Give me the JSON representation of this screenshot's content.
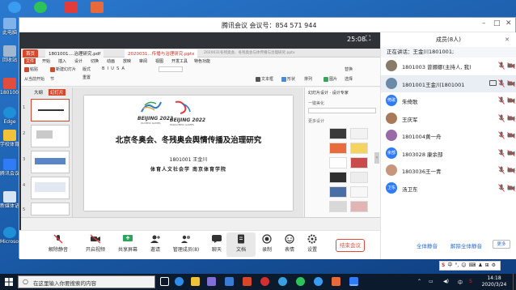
{
  "desktop": {
    "icons": [
      {
        "label": "此电脑",
        "color": "#7fb3ea"
      },
      {
        "label": "回收站",
        "color": "#9fb7cf"
      },
      {
        "label": "1801001.pdf",
        "color": "#e04d3c"
      },
      {
        "label": "Edge",
        "color": "#1f8fd8"
      },
      {
        "label": "学校体育学教学资源",
        "color": "#f0c23a"
      },
      {
        "label": "腾讯会议",
        "color": "#2f7cf6"
      },
      {
        "label": "新媒体语境民健身",
        "color": "#d6e4f3"
      },
      {
        "label": "Microsoft Edge",
        "color": "#1f8fd8"
      }
    ],
    "top_icons": [
      {
        "name": "qq",
        "color": "#3a9cf0"
      },
      {
        "name": "wechat",
        "color": "#2dc35a"
      },
      {
        "name": "voice",
        "color": "#e23b3b"
      },
      {
        "name": "wps",
        "color": "#e86a3a"
      }
    ]
  },
  "meeting": {
    "title": "腾讯会议 会议号：854 571 944",
    "timer": "25:08",
    "toolbar": [
      {
        "label": "解除静音",
        "icon": "mic-muted-icon"
      },
      {
        "label": "开启视频",
        "icon": "camera-off-icon"
      },
      {
        "label": "共享屏幕",
        "icon": "share-screen-icon"
      },
      {
        "label": "邀请",
        "icon": "invite-icon"
      },
      {
        "label": "管理成员(8)",
        "icon": "members-icon"
      },
      {
        "label": "聊天",
        "icon": "chat-icon"
      },
      {
        "label": "文档",
        "icon": "document-icon"
      },
      {
        "label": "录制",
        "icon": "record-icon"
      },
      {
        "label": "表情",
        "icon": "emoji-icon"
      },
      {
        "label": "设置",
        "icon": "settings-icon"
      }
    ],
    "end_button": "结束会议"
  },
  "members_panel": {
    "title": "成员(8人)",
    "speaking": "正在讲话：王金川1801001;",
    "members": [
      {
        "name": "1801003 曾娜娜(主持人, 我)",
        "avatar": "",
        "avatar_color": "#8a7a6a",
        "selected": false
      },
      {
        "name": "1801001王金川1801001",
        "avatar": "",
        "avatar_color": "#6a8aa8",
        "selected": true
      },
      {
        "name": "朱倚歌",
        "avatar": "倚歌",
        "avatar_color": "#2f7cf6",
        "selected": false
      },
      {
        "name": "王庆军",
        "avatar": "",
        "avatar_color": "#a87a5a",
        "selected": false
      },
      {
        "name": "1801004黄一舟",
        "avatar": "",
        "avatar_color": "#9a6aa8",
        "selected": false
      },
      {
        "name": "1803028 康余部",
        "avatar": "余部",
        "avatar_color": "#2f7cf6",
        "selected": false
      },
      {
        "name": "1803036王一青",
        "avatar": "",
        "avatar_color": "#c8967a",
        "selected": false
      },
      {
        "name": "汤卫东",
        "avatar": "卫东",
        "avatar_color": "#2f7cf6",
        "selected": false
      }
    ],
    "mute_all": "全体静音",
    "unmute_all": "解除全体静音",
    "more": "更多"
  },
  "wps": {
    "tabs": [
      "首页",
      "1801001....治理研究.pdf",
      "2020031...传播与治理研究.pptx"
    ],
    "file_title": "2020031冬残奥会、冬残奥会与体传播与治理研究.pptx",
    "menu": [
      "文件",
      "开始",
      "插入",
      "设计",
      "切换",
      "动画",
      "放映",
      "审阅",
      "视图",
      "开发工具",
      "特色功能"
    ],
    "ribbon": [
      "粘贴",
      "新建幻灯片",
      "版式",
      "重置",
      "节",
      "从当前开始",
      "文本框",
      "形状",
      "排列",
      "图片",
      "替换",
      "选择"
    ],
    "thumb_tabs": [
      "大纲",
      "幻灯片"
    ],
    "design_panel": {
      "head": "幻灯片设计 · 设计专家",
      "section1": "一键美化",
      "section2": "更多设计"
    },
    "slide": {
      "left_logo_text": "BEIJING 2022",
      "right_logo_text": "BEIJING 2022",
      "left_sub": "OLYMPIC GAMES",
      "right_sub": "PARALYMPIC GAMES",
      "title": "北京冬奥会、冬残奥会舆情传播及治理研究",
      "author": "1801001 王金川",
      "org": "体育人文社会学 南京体育学院"
    }
  },
  "taskbar": {
    "search_placeholder": "在这里输入你要搜索的内容",
    "time": "14:18",
    "date": "2020/3/24",
    "ime": [
      "S",
      "中",
      "°,",
      "☺",
      "⌨",
      "♟",
      "⊞",
      "⚙"
    ]
  }
}
